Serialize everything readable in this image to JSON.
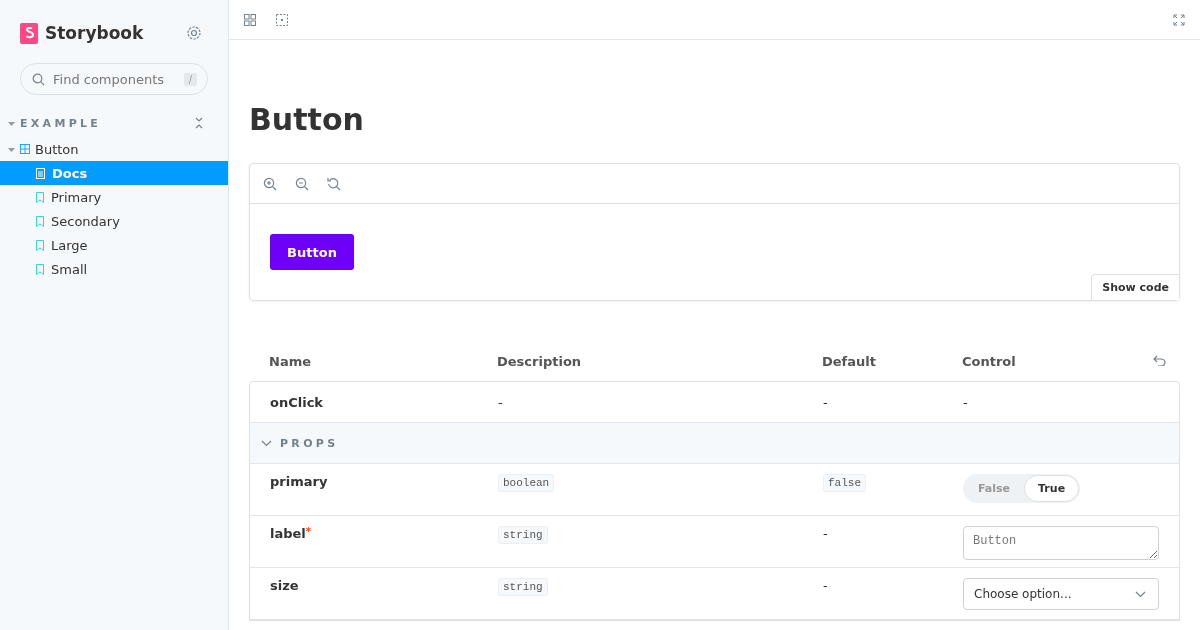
{
  "sidebar": {
    "brand": "Storybook",
    "search": {
      "placeholder": "Find components",
      "shortcut": "/"
    },
    "section": {
      "label": "EXAMPLE",
      "expanded": true
    },
    "tree": [
      {
        "label": "Button",
        "kind": "component",
        "expanded": true,
        "selected": false,
        "children": [
          {
            "label": "Docs",
            "kind": "docs",
            "selected": true
          },
          {
            "label": "Primary",
            "kind": "story",
            "selected": false
          },
          {
            "label": "Secondary",
            "kind": "story",
            "selected": false
          },
          {
            "label": "Large",
            "kind": "story",
            "selected": false
          },
          {
            "label": "Small",
            "kind": "story",
            "selected": false
          }
        ]
      }
    ]
  },
  "main": {
    "title": "Button",
    "preview": {
      "button_label": "Button",
      "show_code": "Show code"
    },
    "table": {
      "columns": [
        "Name",
        "Description",
        "Default",
        "Control"
      ],
      "rows": [
        {
          "kind": "plain",
          "name": "onClick",
          "description": "-",
          "default": "-",
          "control": "-"
        },
        {
          "kind": "section",
          "label": "PROPS",
          "expanded": true
        },
        {
          "kind": "boolean",
          "name": "primary",
          "type": "boolean",
          "default": "false",
          "options": [
            {
              "label": "False",
              "selected": false
            },
            {
              "label": "True",
              "selected": true
            }
          ]
        },
        {
          "kind": "text",
          "name": "label",
          "required_mark": "*",
          "type": "string",
          "default": "-",
          "value": "Button"
        },
        {
          "kind": "select",
          "name": "size",
          "type": "string",
          "default": "-",
          "placeholder": "Choose option..."
        }
      ]
    }
  }
}
